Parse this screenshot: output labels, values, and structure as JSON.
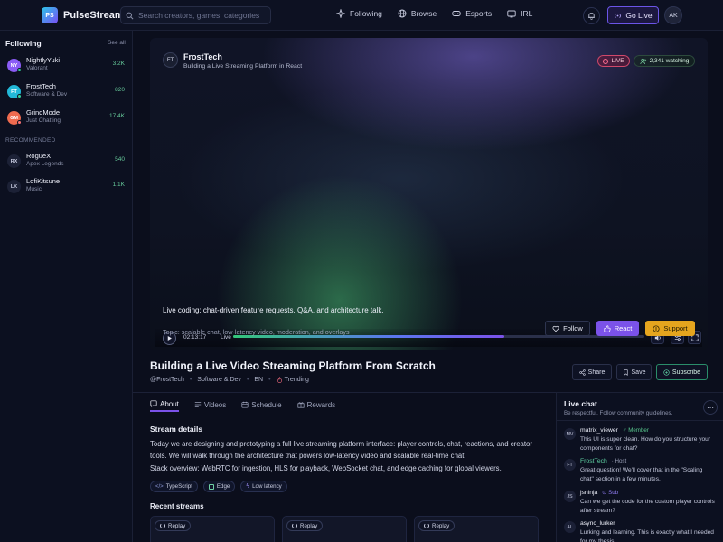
{
  "app": {
    "logo_initials": "PS",
    "name": "PulseStream"
  },
  "search": {
    "placeholder": "Search creators, games, categories"
  },
  "nav": [
    {
      "label": "Following",
      "icon": "sparkle-icon"
    },
    {
      "label": "Browse",
      "icon": "globe-icon"
    },
    {
      "label": "Esports",
      "icon": "gamepad-icon"
    },
    {
      "label": "IRL",
      "icon": "tv-icon"
    }
  ],
  "topbar": {
    "go_live": "Go Live",
    "user_initials": "AK"
  },
  "sidebar": {
    "following_title": "Following",
    "see_all": "See all",
    "recommended_title": "RECOMMENDED",
    "following": [
      {
        "initials": "NY",
        "name": "NightlyYuki",
        "category": "Valorant",
        "count": "3.2K",
        "color": "#8b5cf6",
        "status": "#34d399"
      },
      {
        "initials": "FT",
        "name": "FrostTech",
        "category": "Software & Dev",
        "count": "820",
        "color": "#22b8d8",
        "status": "#34d399"
      },
      {
        "initials": "GM",
        "name": "GrindMode",
        "category": "Just Chatting",
        "count": "17.4K",
        "color": "#ef6b4f",
        "status": "#f87171"
      }
    ],
    "recommended": [
      {
        "initials": "RX",
        "name": "RogueX",
        "category": "Apex Legends",
        "count": "540"
      },
      {
        "initials": "LK",
        "name": "LofiKitsune",
        "category": "Music",
        "count": "1.1K"
      }
    ]
  },
  "player": {
    "streamer_initials": "FT",
    "streamer_name": "FrostTech",
    "stream_subtitle": "Building a Live Streaming Platform in React",
    "live_label": "LIVE",
    "watching": "2,341 watching",
    "description": "Live coding: chat-driven feature requests, Q&A, and architecture talk.",
    "description2": "Topic: scalable chat, low-latency video, moderation, and overlays",
    "follow_label": "Follow",
    "react_label": "React",
    "support_label": "Support",
    "time": "02:13:17",
    "live_small": "Live",
    "progress": 0.66
  },
  "stream": {
    "title": "Building a Live Video Streaming Platform From Scratch",
    "handle": "@FrostTech",
    "category": "Software & Dev",
    "language": "EN",
    "trending": "Trending",
    "share_label": "Share",
    "save_label": "Save",
    "subscribe_label": "Subscribe"
  },
  "tabs": [
    {
      "label": "About",
      "icon": "chat-bubble-icon",
      "active": true
    },
    {
      "label": "Videos",
      "icon": "list-icon",
      "active": false
    },
    {
      "label": "Schedule",
      "icon": "calendar-icon",
      "active": false
    },
    {
      "label": "Rewards",
      "icon": "gift-icon",
      "active": false
    }
  ],
  "about": {
    "heading": "Stream details",
    "p1": "Today we are designing and prototyping a full live streaming platform interface: player controls, chat, reactions, and creator tools. We will walk through the architecture that powers low-latency video and scalable real-time chat.",
    "p2": "Stack overview: WebRTC for ingestion, HLS for playback, WebSocket chat, and edge caching for global viewers.",
    "tags": [
      "TypeScript",
      "Edge",
      "Low latency"
    ],
    "recent_heading": "Recent streams",
    "replay_label": "Replay"
  },
  "chat": {
    "title": "Live chat",
    "subtitle": "Be respectful. Follow community guidelines.",
    "messages": [
      {
        "initials": "MV",
        "user": "matrix_viewer",
        "role": "Member",
        "role_color": "#58c98e",
        "text": "This UI is super clean. How do you structure your components for chat?"
      },
      {
        "initials": "FT",
        "user": "FrostTech",
        "role": "Host",
        "role_color": "#9aa0b8",
        "text": "Great question! We'll cover that in the \"Scaling chat\" section in a few minutes."
      },
      {
        "initials": "JS",
        "user": "jsninja",
        "role": "Sub",
        "role_color": "#8f7bf0",
        "text": "Can we get the code for the custom player controls after stream?"
      },
      {
        "initials": "AL",
        "user": "async_lurker",
        "role": "",
        "role_color": "#9aa0b8",
        "text": "Lurking and learning. This is exactly what I needed for my thesis"
      }
    ]
  }
}
